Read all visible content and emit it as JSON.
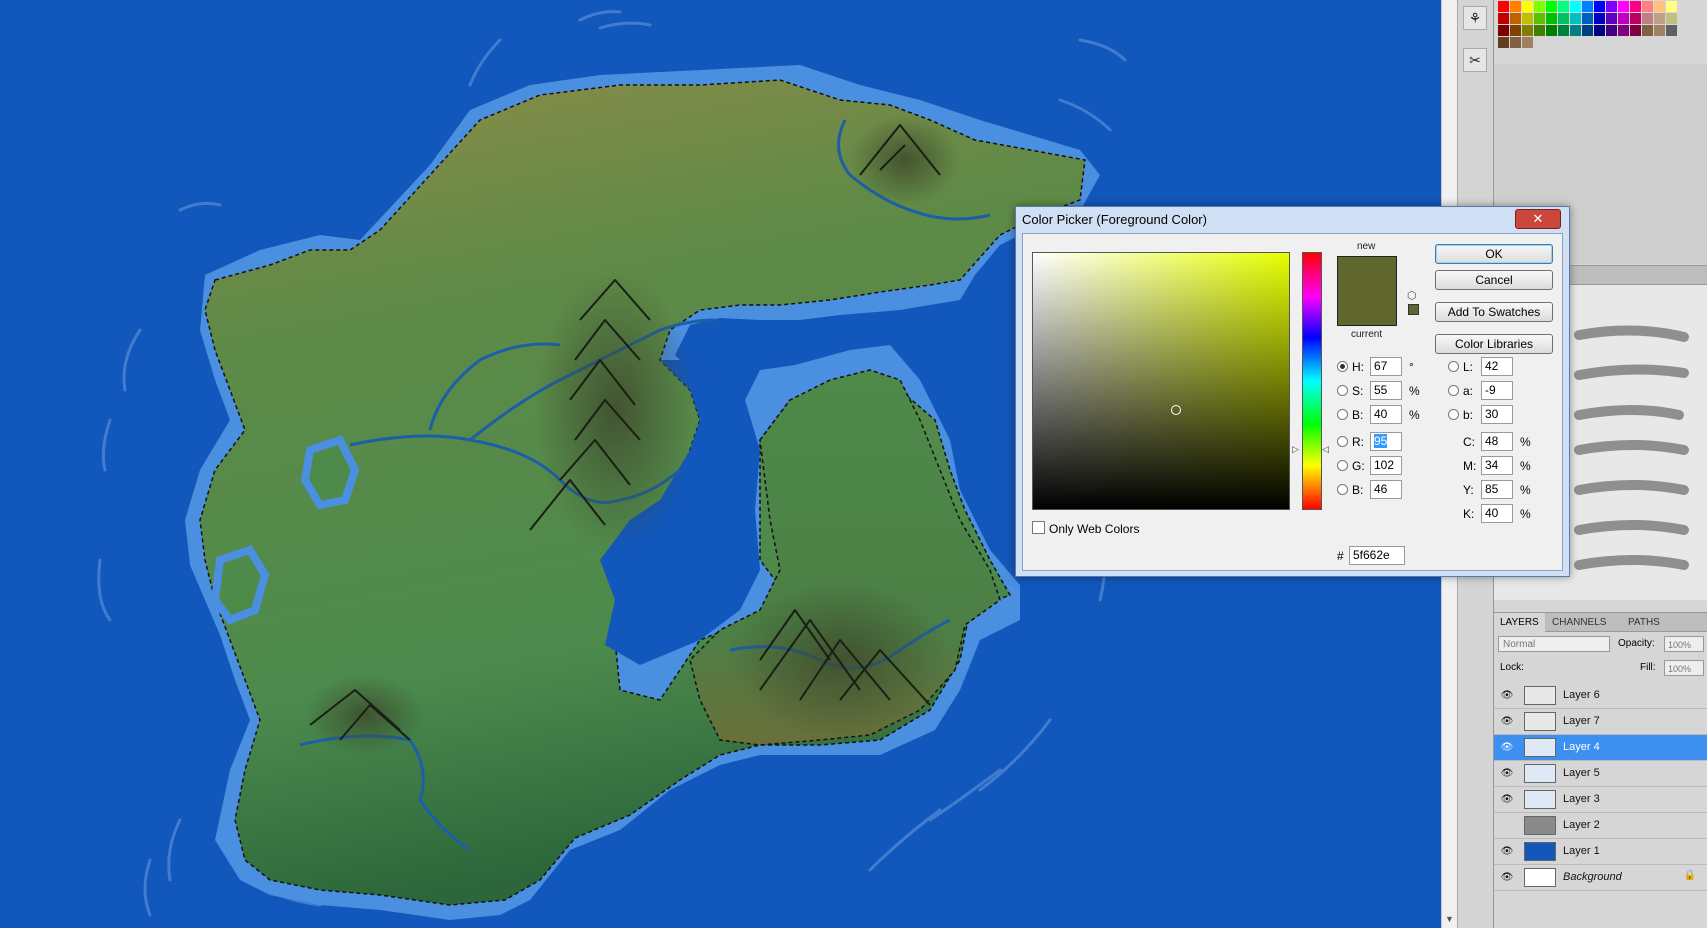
{
  "dialog": {
    "title": "Color Picker (Foreground Color)",
    "close_label": "✕",
    "label_new": "new",
    "label_current": "current",
    "new_color": "#5f662e",
    "current_color": "#5f662e",
    "buttons": {
      "ok": "OK",
      "cancel": "Cancel",
      "add_to_swatches": "Add To Swatches",
      "color_libraries": "Color Libraries"
    },
    "hsb": {
      "h": {
        "label": "H:",
        "value": "67",
        "unit": "°"
      },
      "s": {
        "label": "S:",
        "value": "55",
        "unit": "%"
      },
      "b": {
        "label": "B:",
        "value": "40",
        "unit": "%"
      }
    },
    "rgb": {
      "r": {
        "label": "R:",
        "value": "95"
      },
      "g": {
        "label": "G:",
        "value": "102"
      },
      "b": {
        "label": "B:",
        "value": "46"
      }
    },
    "lab": {
      "l": {
        "label": "L:",
        "value": "42"
      },
      "a": {
        "label": "a:",
        "value": "-9"
      },
      "b": {
        "label": "b:",
        "value": "30"
      }
    },
    "cmyk": {
      "c": {
        "label": "C:",
        "value": "48",
        "unit": "%"
      },
      "m": {
        "label": "M:",
        "value": "34",
        "unit": "%"
      },
      "y": {
        "label": "Y:",
        "value": "85",
        "unit": "%"
      },
      "k": {
        "label": "K:",
        "value": "40",
        "unit": "%"
      }
    },
    "hex_label": "#",
    "hex_value": "5f662e",
    "only_web_colors": "Only Web Colors",
    "hue_field_color": "#e6ff00"
  },
  "layers_panel": {
    "tabs": [
      "LAYERS",
      "CHANNELS",
      "PATHS"
    ],
    "blend_mode": "Normal",
    "opacity_label": "Opacity:",
    "opacity_value": "100%",
    "lock_label": "Lock:",
    "fill_label": "Fill:",
    "fill_value": "100%",
    "layers": [
      {
        "name": "Layer 6",
        "visible": true,
        "selected": false
      },
      {
        "name": "Layer 7",
        "visible": true,
        "selected": false
      },
      {
        "name": "Layer 4",
        "visible": true,
        "selected": true
      },
      {
        "name": "Layer 5",
        "visible": true,
        "selected": false
      },
      {
        "name": "Layer 3",
        "visible": true,
        "selected": false
      },
      {
        "name": "Layer 2",
        "visible": false,
        "selected": false
      },
      {
        "name": "Layer 1",
        "visible": true,
        "selected": false
      },
      {
        "name": "Background",
        "visible": true,
        "selected": false,
        "locked": true
      }
    ]
  },
  "colors": {
    "ocean": "#1257bb",
    "shore": "#4a8fe0",
    "land_olive": "#8a8a45",
    "land_green": "#4e8a4a",
    "land_dark": "#2f6b3c",
    "river": "#1c5fa8",
    "selection_accent": "#3d8ff0"
  }
}
